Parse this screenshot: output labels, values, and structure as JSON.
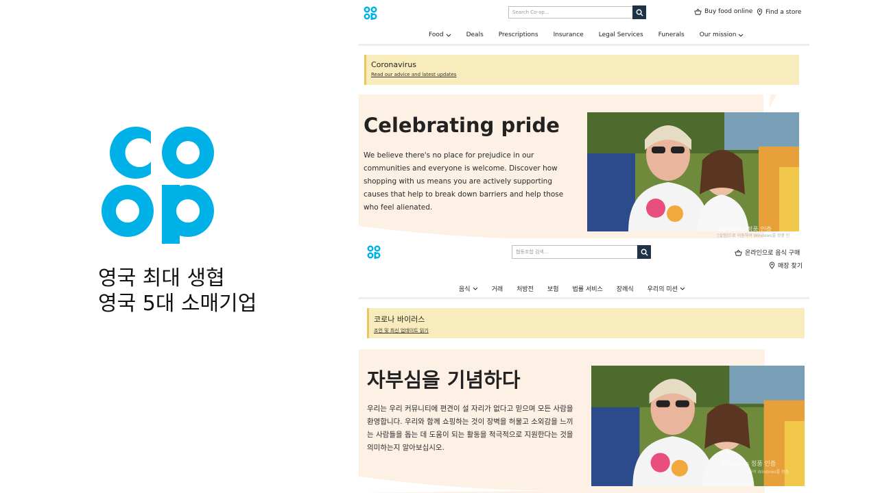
{
  "slide": {
    "logo_top": "co",
    "logo_bottom": "op",
    "caption_line1": "영국 최대 생협",
    "caption_line2": "영국 5대 소매기업",
    "brand_color": "#00b1e7"
  },
  "en": {
    "logo_top": "co",
    "logo_bottom": "op",
    "search_placeholder": "Search Co-op...",
    "buy_food_online": "Buy food online",
    "find_store": "Find a store",
    "nav": [
      "Food",
      "Deals",
      "Prescriptions",
      "Insurance",
      "Legal Services",
      "Funerals",
      "Our mission"
    ],
    "banner_title": "Coronavirus",
    "banner_link": "Read our advice and latest updates",
    "hero_title": "Celebrating pride",
    "hero_body": "We believe there's no place for prejudice in our communities and everyone is welcome. Discover how shopping with us means you are actively supporting causes that help to break down barriers and help those who feel alienated.",
    "watermark_line1": "Windows 정품 인증",
    "watermark_line2": "[설정]으로 이동하여 Windows를 정품 인"
  },
  "ko": {
    "logo_top": "co",
    "logo_bottom": "op",
    "search_placeholder": "협동조합 검색...",
    "buy_food_online": "온라인으로 음식 구매",
    "find_store": "매장 찾기",
    "nav": [
      "음식",
      "거래",
      "처방전",
      "보험",
      "법률 서비스",
      "장례식",
      "우리의 미션"
    ],
    "banner_title": "코로나 바이러스",
    "banner_link": "조언 및 최신 업데이트 읽기",
    "hero_title": "자부심을 기념하다",
    "hero_body": "우리는 우리 커뮤니티에 편견이 설 자리가 없다고 믿으며 모든 사람을 환영합니다. 우리와 함께 쇼핑하는 것이 장벽을 허물고 소외감을 느끼는 사람들을 돕는 데 도움이 되는 활동을 적극적으로 지원한다는 것을 의미하는지 알아보십시오.",
    "watermark_line1": "Windows 정품 인증",
    "watermark_line2": "[설정]으로 이동하여 Windows를 정품"
  }
}
